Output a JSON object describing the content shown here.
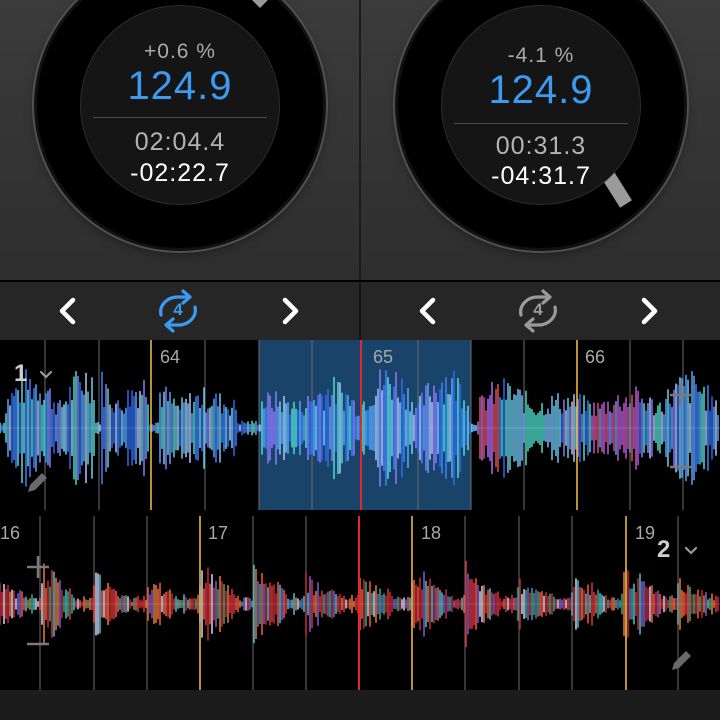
{
  "decks": [
    {
      "pitch": "+0.6 %",
      "bpm": "124.9",
      "elapsed": "02:04.4",
      "remaining": "-02:22.7",
      "loop_count": "4",
      "loop_active": true
    },
    {
      "pitch": "-4.1 %",
      "bpm": "124.9",
      "elapsed": "00:31.3",
      "remaining": "-04:31.7",
      "loop_count": "4",
      "loop_active": false
    }
  ],
  "waveform1": {
    "deck_number": "1",
    "beat_markers": [
      "64",
      "65",
      "66"
    ]
  },
  "waveform2": {
    "deck_number": "2",
    "beat_markers": [
      "16",
      "17",
      "18",
      "19"
    ]
  },
  "icons": {
    "previous": "chevron-left-icon",
    "next": "chevron-right-icon",
    "loop": "loop-icon",
    "deck_menu": "chevron-down-icon",
    "zoom_in": "plus-icon",
    "zoom_out": "minus-icon",
    "edit": "pencil-icon"
  },
  "colors": {
    "accent": "#3a9bf0",
    "inactive": "#9a9a9a",
    "playhead": "#e0282f",
    "downbeat": "#e6b83a",
    "loop_region": "#1e4f7c"
  }
}
